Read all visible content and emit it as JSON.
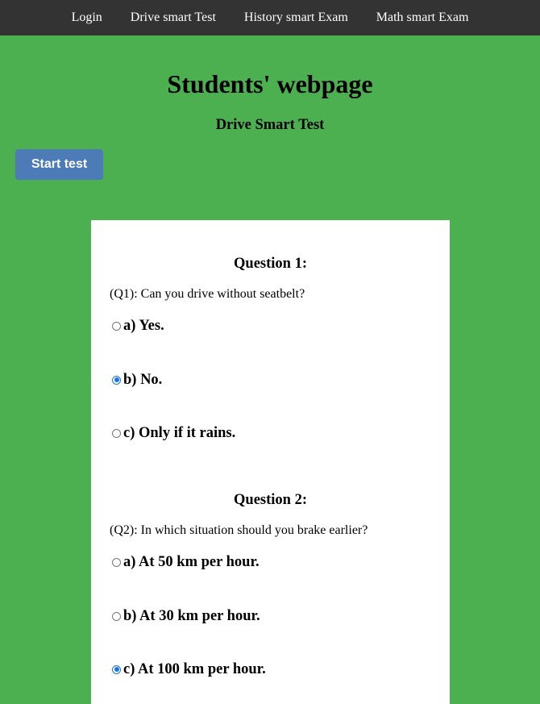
{
  "nav": {
    "items": [
      {
        "label": "Login"
      },
      {
        "label": "Drive smart Test"
      },
      {
        "label": "History smart Exam"
      },
      {
        "label": "Math smart Exam"
      }
    ]
  },
  "page": {
    "title": "Students' webpage",
    "subtitle": "Drive Smart Test",
    "start_button": "Start test"
  },
  "questions": [
    {
      "heading": "Question 1:",
      "text": "(Q1): Can you drive without seatbelt?",
      "options": [
        {
          "label": "a) Yes.",
          "checked": false
        },
        {
          "label": "b) No.",
          "checked": true
        },
        {
          "label": "c) Only if it rains.",
          "checked": false
        }
      ]
    },
    {
      "heading": "Question 2:",
      "text": "(Q2): In which situation should you brake earlier?",
      "options": [
        {
          "label": "a) At 50 km per hour.",
          "checked": false
        },
        {
          "label": "b) At 30 km per hour.",
          "checked": false
        },
        {
          "label": "c) At 100 km per hour.",
          "checked": true
        }
      ]
    }
  ]
}
